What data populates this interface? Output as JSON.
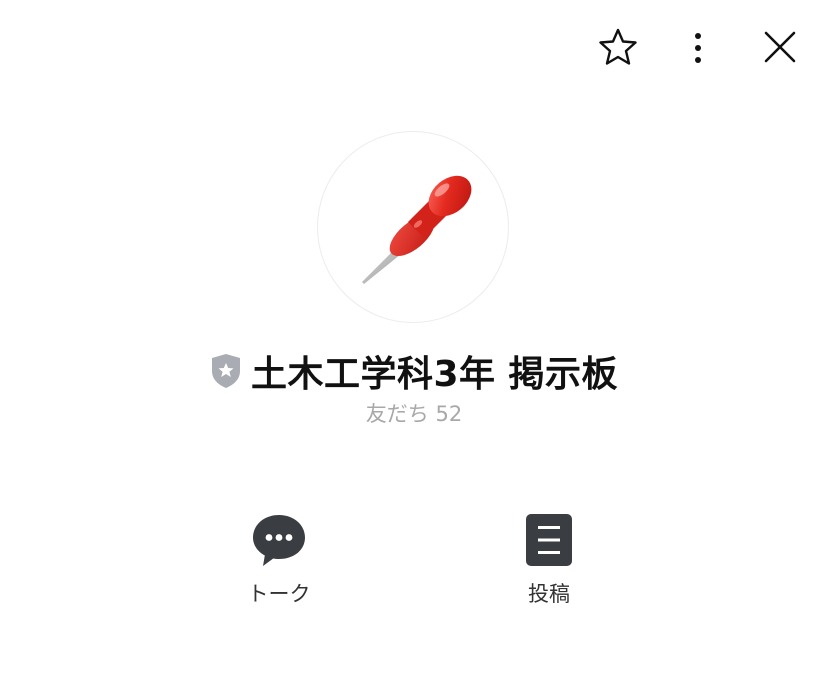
{
  "header": {
    "favorite_icon": "star-outline-icon",
    "more_icon": "more-vertical-icon",
    "close_icon": "close-icon"
  },
  "profile": {
    "avatar_icon": "pushpin-icon",
    "badge_icon": "official-shield-star-icon",
    "name": "土木工学科3年 掲示板",
    "friends_label": "友だち 52"
  },
  "actions": [
    {
      "icon": "chat-bubble-icon",
      "label": "トーク"
    },
    {
      "icon": "post-document-icon",
      "label": "投稿"
    }
  ],
  "colors": {
    "background": "#ffffff",
    "title": "#111111",
    "subtitle": "#a8a8a8",
    "icon_dark": "#3a3d42",
    "badge_gray": "#a9adb3",
    "pin_red": "#e0231c"
  }
}
